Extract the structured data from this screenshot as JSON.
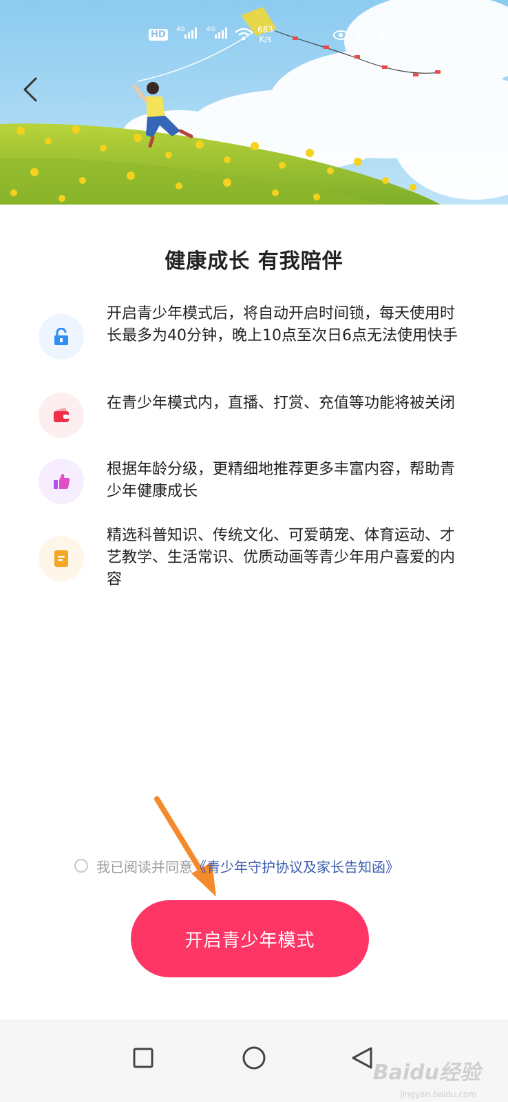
{
  "status_bar": {
    "hd_label": "HD",
    "net1": "4G",
    "net2": "4G",
    "speed_value": "683",
    "speed_unit": "K/s"
  },
  "header": {
    "back_icon": "chevron-left-icon"
  },
  "page": {
    "title": "健康成长 有我陪伴"
  },
  "features": [
    {
      "icon": "unlock-icon",
      "text": "开启青少年模式后，将自动开启时间锁，每天使用时长最多为40分钟，晚上10点至次日6点无法使用快手",
      "color": "#2f8ff5",
      "bg": "#eef5fe"
    },
    {
      "icon": "wallet-icon",
      "text": "在青少年模式内，直播、打赏、充值等功能将被关闭",
      "color": "#f0304a",
      "bg": "#fdeff0"
    },
    {
      "icon": "thumbs-up-icon",
      "text": "根据年龄分级，更精细地推荐更多丰富内容，帮助青少年健康成长",
      "color": "#b44ff0",
      "bg": "#f6eefe"
    },
    {
      "icon": "document-icon",
      "text": "精选科普知识、传统文化、可爱萌宠、体育运动、才艺教学、生活常识、优质动画等青少年用户喜爱的内容",
      "color": "#f5a623",
      "bg": "#fef6e8"
    }
  ],
  "agreement": {
    "prefix": "我已阅读并同意",
    "link": "《青少年守护协议及家长告知函》"
  },
  "main_button": {
    "label": "开启青少年模式",
    "color": "#fe3666"
  },
  "navbar": {
    "recent_icon": "square-icon",
    "home_icon": "circle-icon",
    "back_icon": "triangle-back-icon"
  },
  "watermark": {
    "logo": "Baidu经验",
    "url": "jingyan.baidu.com"
  }
}
